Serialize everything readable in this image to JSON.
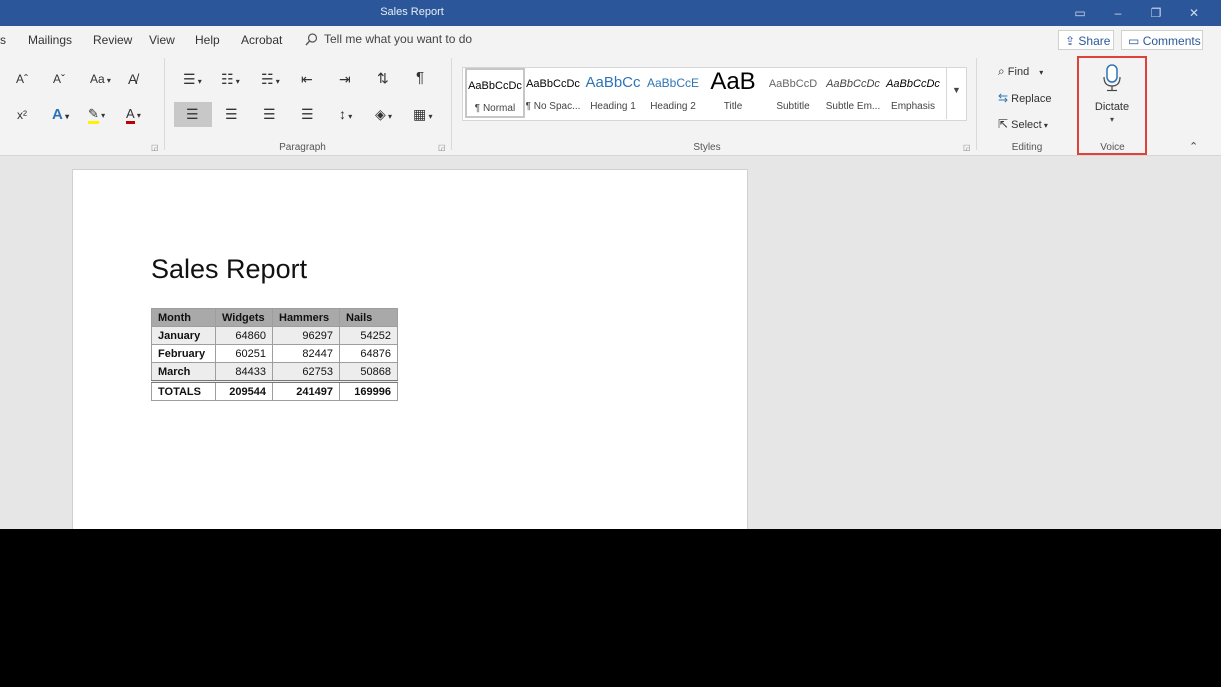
{
  "window": {
    "title": "Sales Report"
  },
  "menu": {
    "items": [
      "s",
      "Mailings",
      "Review",
      "View",
      "Help",
      "Acrobat"
    ],
    "tell_me": "Tell me what you want to do",
    "share": "Share",
    "comments": "Comments"
  },
  "ribbon": {
    "font_group": {
      "grow": "Aˆ",
      "shrink": "Aˇ",
      "change_case": "Aa",
      "superscript": "x²"
    },
    "paragraph_label": "Paragraph",
    "styles_label": "Styles",
    "editing_label": "Editing",
    "voice_label": "Voice",
    "styles": [
      {
        "preview": "AaBbCcDc",
        "label": "¶ Normal"
      },
      {
        "preview": "AaBbCcDc",
        "label": "¶ No Spac..."
      },
      {
        "preview": "AaBbCc",
        "label": "Heading 1"
      },
      {
        "preview": "AaBbCcE",
        "label": "Heading 2"
      },
      {
        "preview": "AaB",
        "label": "Title"
      },
      {
        "preview": "AaBbCcD",
        "label": "Subtitle"
      },
      {
        "preview": "AaBbCcDc",
        "label": "Subtle Em..."
      },
      {
        "preview": "AaBbCcDc",
        "label": "Emphasis"
      }
    ],
    "editing": {
      "find": "Find",
      "replace": "Replace",
      "select": "Select"
    },
    "voice": {
      "dictate": "Dictate"
    }
  },
  "document": {
    "title": "Sales Report",
    "table": {
      "headers": [
        "Month",
        "Widgets",
        "Hammers",
        "Nails"
      ],
      "rows": [
        [
          "January",
          "64860",
          "96297",
          "54252"
        ],
        [
          "February",
          "60251",
          "82447",
          "64876"
        ],
        [
          "March",
          "84433",
          "62753",
          "50868"
        ]
      ],
      "totals": [
        "TOTALS",
        "209544",
        "241497",
        "169996"
      ]
    }
  },
  "colors": {
    "titlebar": "#2b579a",
    "highlight": "#e0413b",
    "heading": "#2e74b5"
  }
}
